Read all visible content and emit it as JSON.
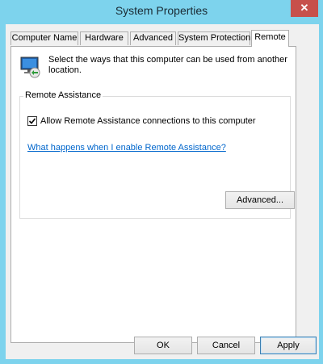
{
  "window": {
    "title": "System Properties",
    "close_glyph": "✕"
  },
  "tabs": [
    {
      "label": "Computer Name",
      "selected": false
    },
    {
      "label": "Hardware",
      "selected": false
    },
    {
      "label": "Advanced",
      "selected": false
    },
    {
      "label": "System Protection",
      "selected": false
    },
    {
      "label": "Remote",
      "selected": true
    }
  ],
  "intro": {
    "icon": "remote-computer-icon",
    "text": "Select the ways that this computer can be used from another location."
  },
  "remote_assistance": {
    "group_label": "Remote Assistance",
    "checkbox_label": "Allow Remote Assistance connections to this computer",
    "checked": true,
    "help_link": "What happens when I enable Remote Assistance?",
    "advanced_button": "Advanced..."
  },
  "footer": {
    "ok": "OK",
    "cancel": "Cancel",
    "apply": "Apply"
  },
  "colors": {
    "title_bar": "#7dd3ed",
    "close_button": "#c7504b",
    "link": "#0066cc"
  }
}
